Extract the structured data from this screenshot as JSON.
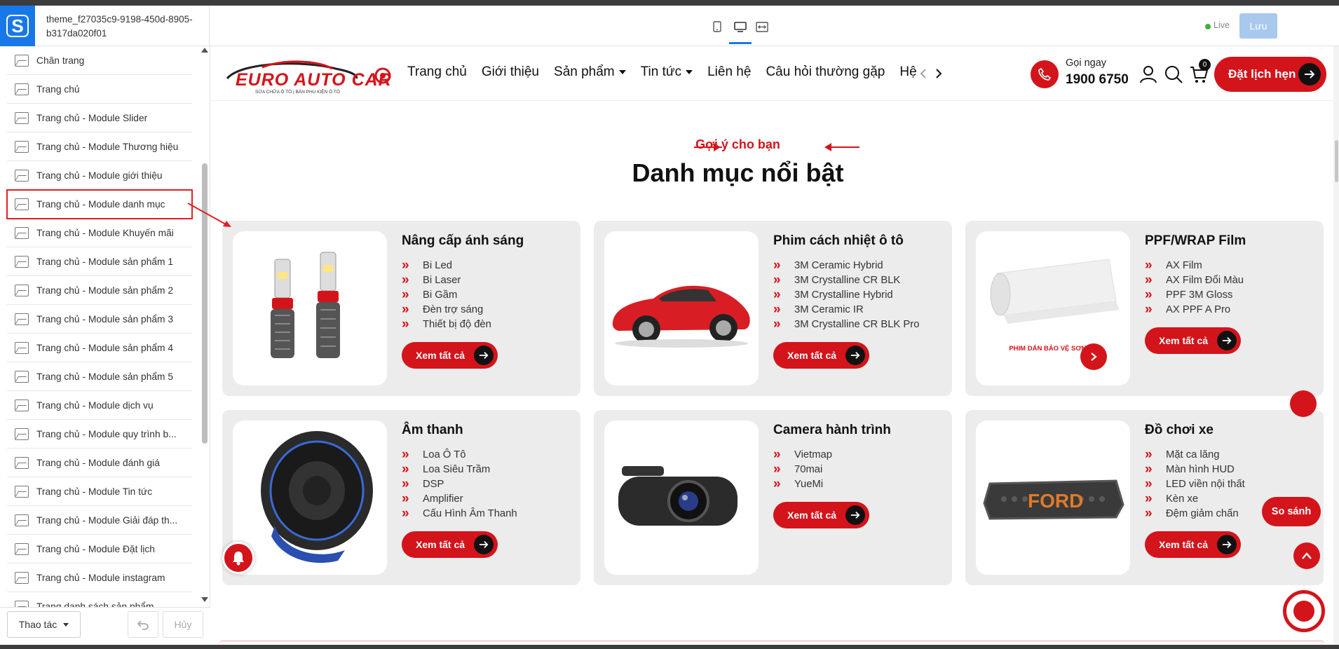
{
  "editor": {
    "theme_name": "theme_f27035c9-9198-450d-8905-b317da020f01",
    "live_label": "Live",
    "save_label": "Lưu",
    "colors": {
      "accent": "#1878e8",
      "brand_red": "#d3141b"
    }
  },
  "sidebar": {
    "items": [
      {
        "label": "Chân trang"
      },
      {
        "label": "Trang chủ"
      },
      {
        "label": "Trang chủ - Module Slider"
      },
      {
        "label": "Trang chủ - Module Thương hiệu"
      },
      {
        "label": "Trang chủ - Module giới thiệu"
      },
      {
        "label": "Trang chủ - Module danh mục"
      },
      {
        "label": "Trang chủ - Module Khuyến mãi"
      },
      {
        "label": "Trang chủ - Module sản phẩm 1"
      },
      {
        "label": "Trang chủ - Module sản phẩm 2"
      },
      {
        "label": "Trang chủ - Module sản phẩm 3"
      },
      {
        "label": "Trang chủ - Module sản phẩm 4"
      },
      {
        "label": "Trang chủ - Module sản phẩm 5"
      },
      {
        "label": "Trang chủ - Module dịch vụ"
      },
      {
        "label": "Trang chủ - Module quy trình b..."
      },
      {
        "label": "Trang chủ - Module đánh giá"
      },
      {
        "label": "Trang chủ - Module Tin tức"
      },
      {
        "label": "Trang chủ - Module Giải đáp th..."
      },
      {
        "label": "Trang chủ - Module Đặt lịch"
      },
      {
        "label": "Trang chủ - Module instagram"
      },
      {
        "label": "Trang danh sách sản phẩm"
      }
    ],
    "actions_label": "Thao tác",
    "cancel_label": "Hủy"
  },
  "site": {
    "brand": {
      "name": "EURO AUTO CAR",
      "tagline": "SỬA CHỮA Ô TÔ  |  BÁN PHỤ KIỆN Ô TÔ"
    },
    "nav": [
      "Trang chủ",
      "Giới thiệu",
      "Sản phẩm",
      "Tin tức",
      "Liên hệ",
      "Câu hỏi thường gặp",
      "Hệ"
    ],
    "phone_label": "Gọi ngay",
    "phone_number": "1900 6750",
    "cart_count": "0",
    "book_label": "Đặt lịch hẹn",
    "section_subtitle": "Gợi ý cho bạn",
    "section_title": "Danh mục nổi bật",
    "see_all_label": "Xem tất cả",
    "cards": [
      {
        "title": "Nâng cấp ánh sáng",
        "items": [
          "Bi Led",
          "Bi Laser",
          "Bi Gầm",
          "Đèn trợ sáng",
          "Thiết bị độ đèn"
        ]
      },
      {
        "title": "Phim cách nhiệt ô tô",
        "items": [
          "3M Ceramic Hybrid",
          "3M Crystalline CR BLK",
          "3M Crystalline Hybrid",
          "3M Ceramic IR",
          "3M Crystalline CR BLK Pro"
        ]
      },
      {
        "title": "PPF/WRAP Film",
        "items": [
          "AX Film",
          "AX Film Đổi Màu",
          "PPF 3M Gloss",
          "AX PPF A Pro"
        ],
        "image_caption": "PHIM DÁN BẢO VỆ SƠN XE"
      },
      {
        "title": "Âm thanh",
        "items": [
          "Loa Ô Tô",
          "Loa Siêu Trầm",
          "DSP",
          "Amplifier",
          "Cấu Hình Âm Thanh"
        ]
      },
      {
        "title": "Camera hành trình",
        "items": [
          "Vietmap",
          "70mai",
          "YueMi"
        ]
      },
      {
        "title": "Đồ chơi xe",
        "items": [
          "Mặt ca lăng",
          "Màn hình HUD",
          "LED viền nội thất",
          "Kèn xe",
          "Đệm giảm chấn"
        ]
      }
    ],
    "compare_label": "So sánh"
  }
}
